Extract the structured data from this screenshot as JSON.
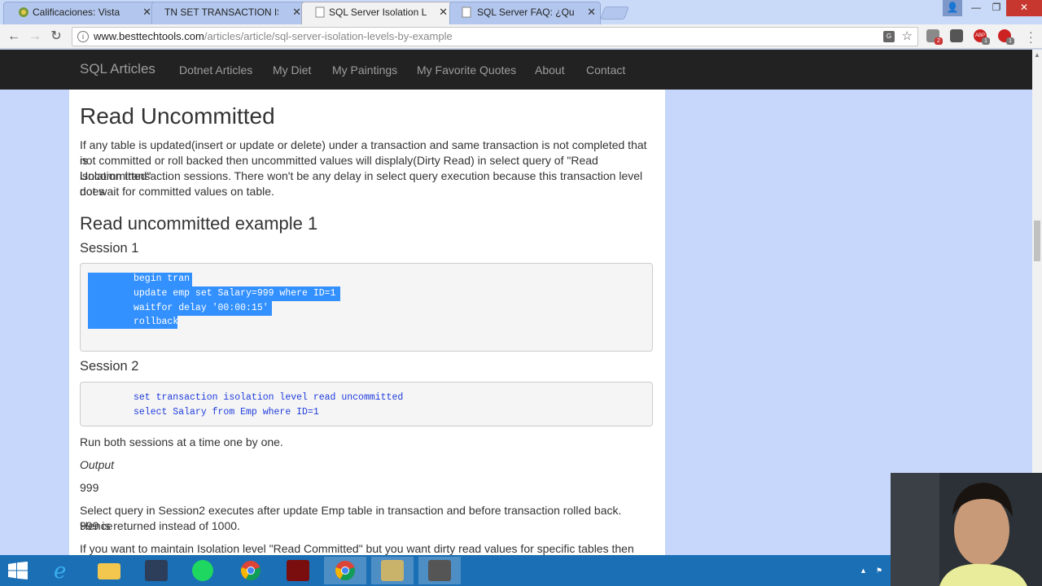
{
  "browser": {
    "tabs": [
      {
        "title": "Calificaciones: Vista",
        "active": false
      },
      {
        "title": "TN  SET TRANSACTION ISOL",
        "active": false
      },
      {
        "title": "SQL Server Isolation Leve",
        "active": true
      },
      {
        "title": "SQL Server FAQ: ¿Qué es",
        "active": false
      }
    ],
    "url_host": "www.besttechtools.com",
    "url_path": "/articles/article/sql-server-isolation-levels-by-example",
    "extension_badges": [
      "2",
      "1",
      "1"
    ]
  },
  "navbar": {
    "brand": "SQL Articles",
    "links": [
      "Dotnet Articles",
      "My Diet",
      "My Paintings",
      "My Favorite Quotes",
      "About",
      "Contact"
    ]
  },
  "article": {
    "title": "Read Uncommitted",
    "intro": [
      "If any table is updated(insert or update or delete) under a transaction and same transaction is not completed that is",
      "not committed or roll backed then uncommitted values will displaly(Dirty Read) in select query of \"Read Uncommitted\"",
      "isolation transaction sessions. There won't be any delay in select query execution because this transaction level does",
      "not wait for committed values on table."
    ],
    "example_title": "Read uncommitted example 1",
    "session1_title": "Session 1",
    "session1_code": [
      "begin tran",
      "update emp set Salary=999 where ID=1",
      "waitfor delay '00:00:15'",
      "rollback"
    ],
    "session2_title": "Session 2",
    "session2_code": [
      "set transaction isolation level read uncommitted",
      "select Salary from Emp where ID=1"
    ],
    "run_text": "Run both sessions at a time one by one.",
    "output_label": "Output",
    "output_value": "999",
    "explain": [
      "Select query in Session2 executes after update Emp table in transaction and before transaction rolled back. Hence",
      "999 is returned instead of 1000."
    ],
    "last_line": "If you want to maintain Isolation level \"Read Committed\" but you want dirty read values for specific tables then use"
  },
  "taskbar": {
    "items": [
      "start-button",
      "internet-explorer-icon",
      "file-explorer-icon",
      "sql-server-management-studio-icon",
      "spotify-icon",
      "chrome-icon",
      "acrobat-icon",
      "chrome-icon",
      "tools-icon",
      "installer-icon"
    ]
  },
  "colors": {
    "selection": "#3390ff",
    "code_blue": "#1f3cdc",
    "navbar_bg": "#222222",
    "page_bg": "#c6d7fb",
    "taskbar_bg": "#1b6fb5"
  }
}
